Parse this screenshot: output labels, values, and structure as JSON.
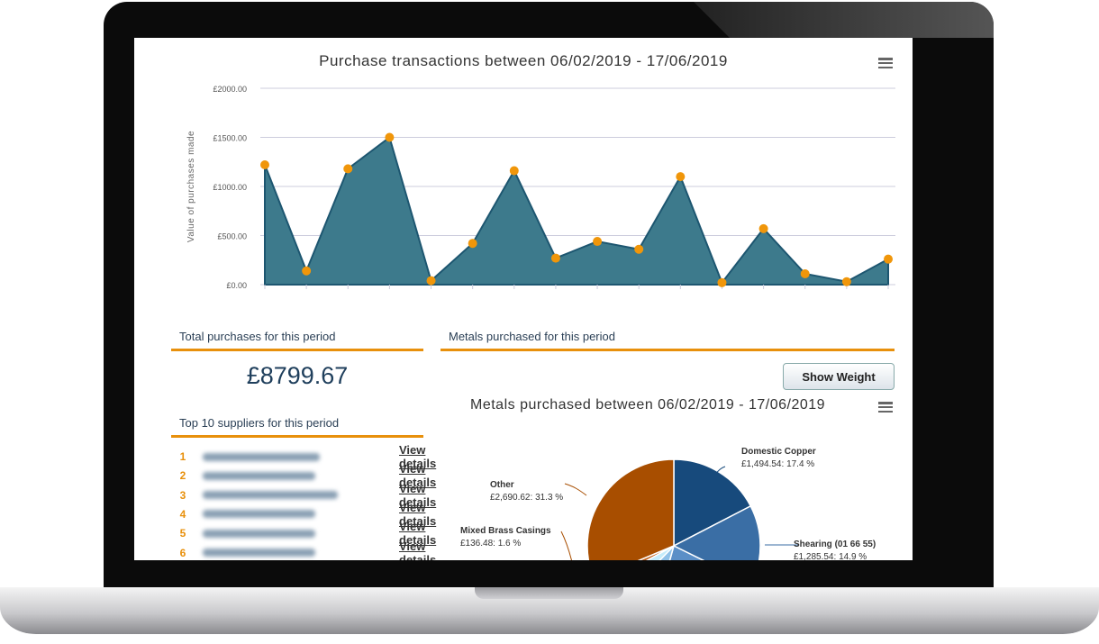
{
  "line_chart": {
    "title": "Purchase transactions between 06/02/2019 - 17/06/2019",
    "ylabel": "Value of purchases made",
    "yticks": [
      "£0.00",
      "£500.00",
      "£1000.00",
      "£1500.00",
      "£2000.00"
    ],
    "ylim": [
      0,
      2000
    ],
    "color": "#3d7a8c",
    "marker_color": "#f0960a",
    "menu_icon": "hamburger-icon"
  },
  "chart_data": [
    {
      "type": "area",
      "title": "Purchase transactions between 06/02/2019 - 17/06/2019",
      "ylabel": "Value of purchases made",
      "ylim": [
        0,
        2000
      ],
      "grid": true,
      "values": [
        1220,
        140,
        1180,
        1500,
        40,
        420,
        1160,
        270,
        440,
        360,
        1100,
        20,
        570,
        110,
        30,
        260
      ]
    },
    {
      "type": "pie",
      "title": "Metals purchased between 06/02/2019 - 17/06/2019",
      "slices": [
        {
          "name": "Domestic Copper",
          "value": "£1,494.54",
          "percent": 17.4,
          "color": "#174a7c"
        },
        {
          "name": "Shearing (01 66 55)",
          "value": "£1,285.54",
          "percent": 14.9,
          "color": "#3a6ea5"
        },
        {
          "name": "",
          "percent": 22.0,
          "color": "#5b8fc7"
        },
        {
          "name": "",
          "percent": 8.0,
          "color": "#8fc1e8"
        },
        {
          "name": "",
          "percent": 4.8,
          "color": "#c5ecfa"
        },
        {
          "name": "Mixed Brass Casings",
          "value": "£136.48",
          "percent": 1.6,
          "color": "#c0601a"
        },
        {
          "name": "Other",
          "value": "£2,690.62",
          "percent": 31.3,
          "color": "#a84e00"
        }
      ]
    }
  ],
  "totals": {
    "heading": "Total purchases for this period",
    "value": "£8799.67"
  },
  "metals": {
    "heading": "Metals purchased for this period",
    "button": "Show Weight",
    "title": "Metals purchased between 06/02/2019 - 17/06/2019"
  },
  "suppliers": {
    "heading": "Top 10 suppliers for this period",
    "ranks": [
      "1",
      "2",
      "3",
      "4",
      "5",
      "6"
    ],
    "link": "View details"
  }
}
